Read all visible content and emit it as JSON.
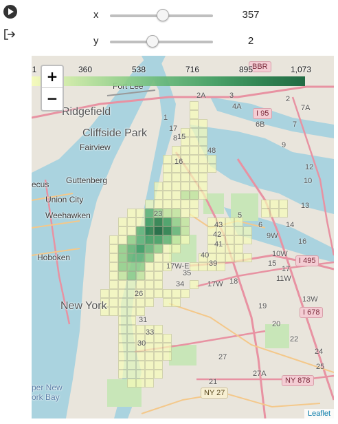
{
  "toolbar": {
    "play_icon": "play-circle-icon",
    "export_icon": "export-icon"
  },
  "sliders": {
    "x": {
      "label": "x",
      "value": "357",
      "min": 0,
      "max": 1000,
      "fraction": 0.51
    },
    "y": {
      "label": "y",
      "value": "2",
      "min": 0,
      "max": 6,
      "fraction": 0.41
    }
  },
  "map": {
    "colorbar": {
      "ticks": [
        "1",
        "360",
        "538",
        "716",
        "895",
        "1,073"
      ],
      "colors": [
        "#f7fcb9",
        "#c2e6a0",
        "#8fcf88",
        "#5fb373",
        "#3a9a5c",
        "#1e7a44",
        "#0b5d33"
      ]
    },
    "zoom": {
      "in_label": "+",
      "out_label": "−"
    },
    "attribution": "Leaflet",
    "labels": {
      "fort_lee": "Fort Lee",
      "ridgefield": "Ridgefield",
      "cliffside_park": "Cliffside Park",
      "fairview": "Fairview",
      "guttenberg": "Guttenberg",
      "union_city": "Union City",
      "weehawken": "Weehawken",
      "hoboken": "Hoboken",
      "new_york": "New York",
      "ecus": "ecus",
      "bay": "per New\nork Bay"
    },
    "road_badges": {
      "i95": "I 95",
      "i495": "I 495",
      "i678": "I 678",
      "ny878": "NY 878",
      "ny27": "NY 27",
      "top_badge": "BBR"
    },
    "exit_numbers": [
      "2A",
      "3",
      "4A",
      "2",
      "7A",
      "6B",
      "7",
      "9",
      "48",
      "12",
      "10",
      "13",
      "43",
      "42",
      "41",
      "40",
      "39",
      "17W-E",
      "17W",
      "18",
      "34",
      "35",
      "31",
      "33",
      "30",
      "10W",
      "11W",
      "9W",
      "13W",
      "14",
      "16",
      "15",
      "17",
      "19",
      "20",
      "22",
      "27A",
      "27",
      "21",
      "24",
      "25",
      "26",
      "5",
      "6",
      "8",
      "1",
      "17",
      "16",
      "23",
      "15",
      "E"
    ]
  }
}
